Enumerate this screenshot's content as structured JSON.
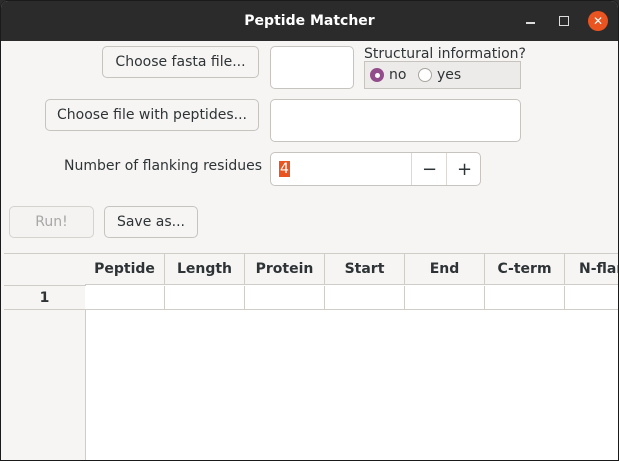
{
  "window": {
    "title": "Peptide Matcher",
    "close_color": "#e95420",
    "minimize_icon": "minimize-icon",
    "maximize_icon": "maximize-icon",
    "close_icon": "close-icon"
  },
  "controls": {
    "choose_fasta_label": "Choose fasta file...",
    "fasta_value": "",
    "structural_label": "Structural information?",
    "radio_no_label": "no",
    "radio_yes_label": "yes",
    "structural_selected": "no",
    "choose_peptides_label": "Choose file with peptides...",
    "peptides_value": "",
    "flanking_label": "Number of flanking residues",
    "flanking_value": "4",
    "minus_symbol": "−",
    "plus_symbol": "+",
    "run_label": "Run!",
    "save_label": "Save as...",
    "accent_color": "#924d8b",
    "selection_color": "#e95420"
  },
  "table": {
    "columns": [
      "Peptide",
      "Length",
      "Protein",
      "Start",
      "End",
      "C-term",
      "N-flank"
    ],
    "rows": [
      {
        "header": "1",
        "cells": [
          "",
          "",
          "",
          "",
          "",
          "",
          ""
        ]
      }
    ]
  }
}
